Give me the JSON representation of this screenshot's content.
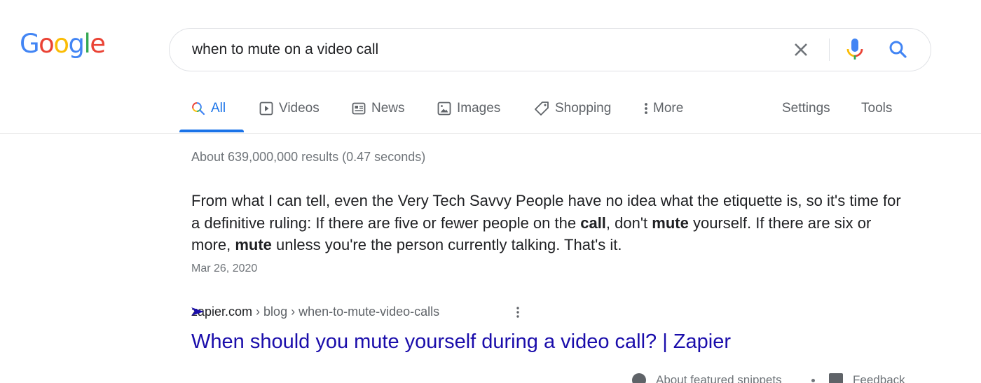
{
  "logo": {
    "text": "Google",
    "letters": [
      {
        "ch": "G",
        "color": "#4285f4"
      },
      {
        "ch": "o",
        "color": "#ea4335"
      },
      {
        "ch": "o",
        "color": "#fbbc05"
      },
      {
        "ch": "g",
        "color": "#4285f4"
      },
      {
        "ch": "l",
        "color": "#34a853"
      },
      {
        "ch": "e",
        "color": "#ea4335"
      }
    ]
  },
  "search": {
    "query": "when to mute on a video call",
    "clear_icon": "close-icon",
    "voice_icon": "mic-icon",
    "search_icon": "search-icon"
  },
  "tabs": [
    {
      "label": "All",
      "icon": "search-icon",
      "active": true
    },
    {
      "label": "Videos",
      "icon": "play-icon",
      "active": false
    },
    {
      "label": "News",
      "icon": "newspaper-icon",
      "active": false
    },
    {
      "label": "Images",
      "icon": "image-icon",
      "active": false
    },
    {
      "label": "Shopping",
      "icon": "tag-icon",
      "active": false
    },
    {
      "label": "More",
      "icon": "more-vert-icon",
      "active": false
    }
  ],
  "tools": {
    "settings_label": "Settings",
    "tools_label": "Tools"
  },
  "stats": "About 639,000,000 results (0.47 seconds)",
  "featured_snippet": {
    "segments": [
      {
        "text": "From what I can tell, even the Very Tech Savvy People have no idea what the etiquette is, so it's time for a definitive ruling: If there are five or fewer people on the ",
        "bold": false
      },
      {
        "text": "call",
        "bold": true
      },
      {
        "text": ", don't ",
        "bold": false
      },
      {
        "text": "mute",
        "bold": true
      },
      {
        "text": " yourself. If there are six or more, ",
        "bold": false
      },
      {
        "text": "mute",
        "bold": true
      },
      {
        "text": " unless you're the person currently talking. That's it.",
        "bold": false
      }
    ],
    "date": "Mar 26, 2020",
    "cite": {
      "domain": "zapier.com",
      "path": " › blog › when-to-mute-video-calls"
    },
    "title": "When should you mute yourself during a video call? | Zapier",
    "about_label": "About featured snippets",
    "feedback_label": "Feedback"
  },
  "colors": {
    "accent": "#1a73e8",
    "link": "#1a0dab",
    "muted": "#70757a"
  }
}
